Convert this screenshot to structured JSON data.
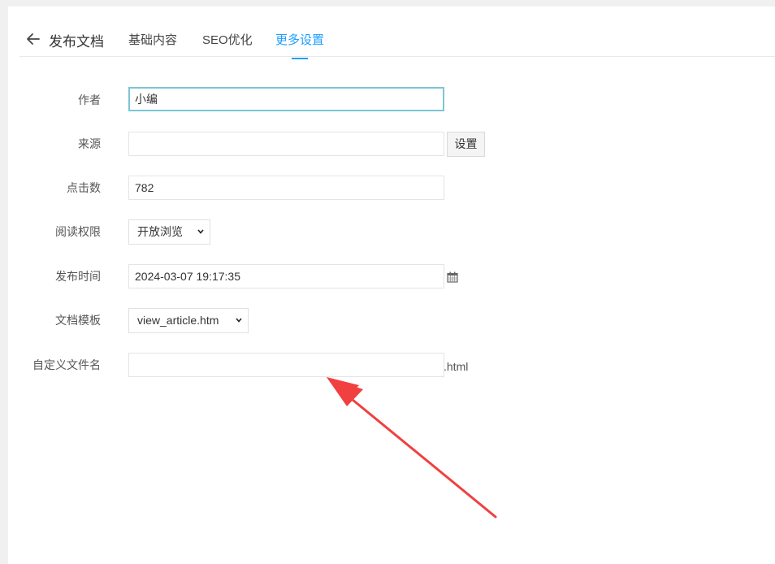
{
  "header": {
    "title": "发布文档",
    "tabs": [
      {
        "label": "基础内容"
      },
      {
        "label": "SEO优化"
      },
      {
        "label": "更多设置"
      }
    ]
  },
  "form": {
    "author": {
      "label": "作者",
      "value": "小编"
    },
    "source": {
      "label": "来源",
      "value": "",
      "button": "设置"
    },
    "clicks": {
      "label": "点击数",
      "value": "782"
    },
    "permission": {
      "label": "阅读权限",
      "selected": "开放浏览"
    },
    "publish_time": {
      "label": "发布时间",
      "value": "2024-03-07 19:17:35"
    },
    "template": {
      "label": "文档模板",
      "selected": "view_article.htm"
    },
    "filename": {
      "label": "自定义文件名",
      "value": "",
      "suffix": ".html"
    }
  },
  "colors": {
    "accent": "#1e9fff",
    "focus_border": "#7cc5d6",
    "annotation_arrow": "#f04040"
  },
  "icons": {
    "back": "arrow-left-icon",
    "calendar": "calendar-icon",
    "dropdown": "chevron-down-icon"
  }
}
